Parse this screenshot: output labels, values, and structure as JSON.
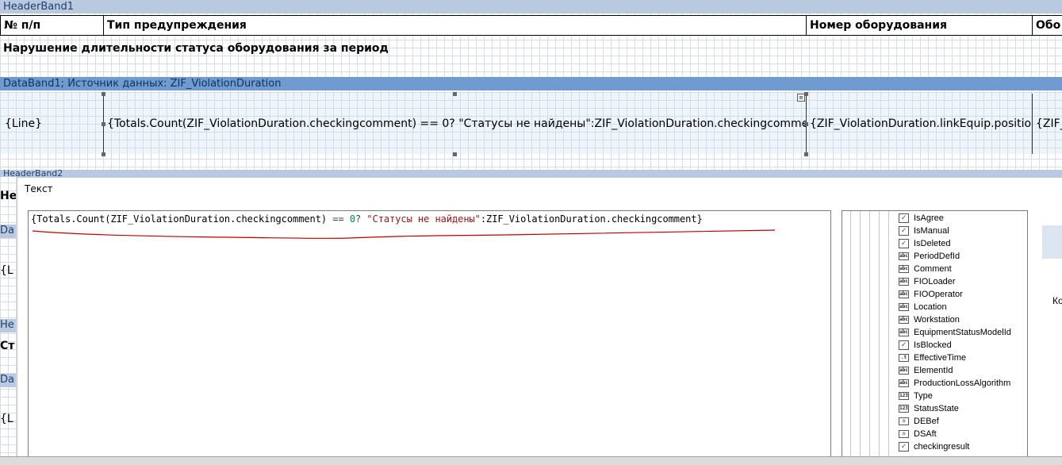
{
  "designer": {
    "header_band1": "HeaderBand1",
    "columns": [
      "№ п/п",
      "Тип предупреждения",
      "Номер оборудования",
      "Обо"
    ],
    "section_title": "Нарушение длительности статуса оборудования за период",
    "data_band1": "DataBand1; Источник данных: ZIF_ViolationDuration",
    "data_cells": [
      "{Line}",
      "{Totals.Count(ZIF_ViolationDuration.checkingcomment) == 0? \"Статусы не найдены\":ZIF_ViolationDuration.checkingcomment}",
      "{ZIF_ViolationDuration.linkEquip.position}",
      "{ZIF_"
    ],
    "left_fragments": [
      "HeaderBand2",
      "Не",
      "Da",
      "{L",
      "He",
      "Ст",
      "Da",
      "{L"
    ]
  },
  "dialog": {
    "title": "Текст",
    "expression_parts": [
      {
        "text": "{Totals.Count(ZIF_ViolationDuration.checkingcomment) ",
        "kind": "plain"
      },
      {
        "text": "==",
        "kind": "op"
      },
      {
        "text": " ",
        "kind": "plain"
      },
      {
        "text": "0",
        "kind": "num"
      },
      {
        "text": "? ",
        "kind": "op"
      },
      {
        "text": "\"Статусы не найдены\"",
        "kind": "str"
      },
      {
        "text": ":ZIF_ViolationDuration.checkingcomment}",
        "kind": "plain"
      }
    ],
    "tree_items": [
      {
        "label": "IsAgree",
        "icon": "checkbox-icon"
      },
      {
        "label": "IsManual",
        "icon": "checkbox-icon"
      },
      {
        "label": "IsDeleted",
        "icon": "checkbox-icon"
      },
      {
        "label": "PeriodDefId",
        "icon": "string-icon"
      },
      {
        "label": "Comment",
        "icon": "string-icon"
      },
      {
        "label": "FIOLoader",
        "icon": "string-icon"
      },
      {
        "label": "FIOOperator",
        "icon": "string-icon"
      },
      {
        "label": "Location",
        "icon": "string-icon"
      },
      {
        "label": "Workstation",
        "icon": "string-icon"
      },
      {
        "label": "EquipmentStatusModelId",
        "icon": "string-icon"
      },
      {
        "label": "IsBlocked",
        "icon": "checkbox-icon"
      },
      {
        "label": "EffectiveTime",
        "icon": "time-icon"
      },
      {
        "label": "ElementId",
        "icon": "string-icon"
      },
      {
        "label": "ProductionLossAlgorithm",
        "icon": "string-icon"
      },
      {
        "label": "Type",
        "icon": "number-icon"
      },
      {
        "label": "StatusState",
        "icon": "number-icon"
      },
      {
        "label": "DEBef",
        "icon": "clock-icon"
      },
      {
        "label": "DSAft",
        "icon": "clock-icon"
      },
      {
        "label": "checkingresult",
        "icon": "checkbox-icon"
      }
    ],
    "icon_glyphs": {
      "checkbox-icon": "✓",
      "string-icon": "abc",
      "time-icon": ".t",
      "number-icon": "123",
      "clock-icon": "◷"
    },
    "right_label": "Ко"
  },
  "colors": {
    "band_light": "#b9c9e0",
    "band_dark": "#6f9bd0",
    "underline_red": "#c00000"
  }
}
